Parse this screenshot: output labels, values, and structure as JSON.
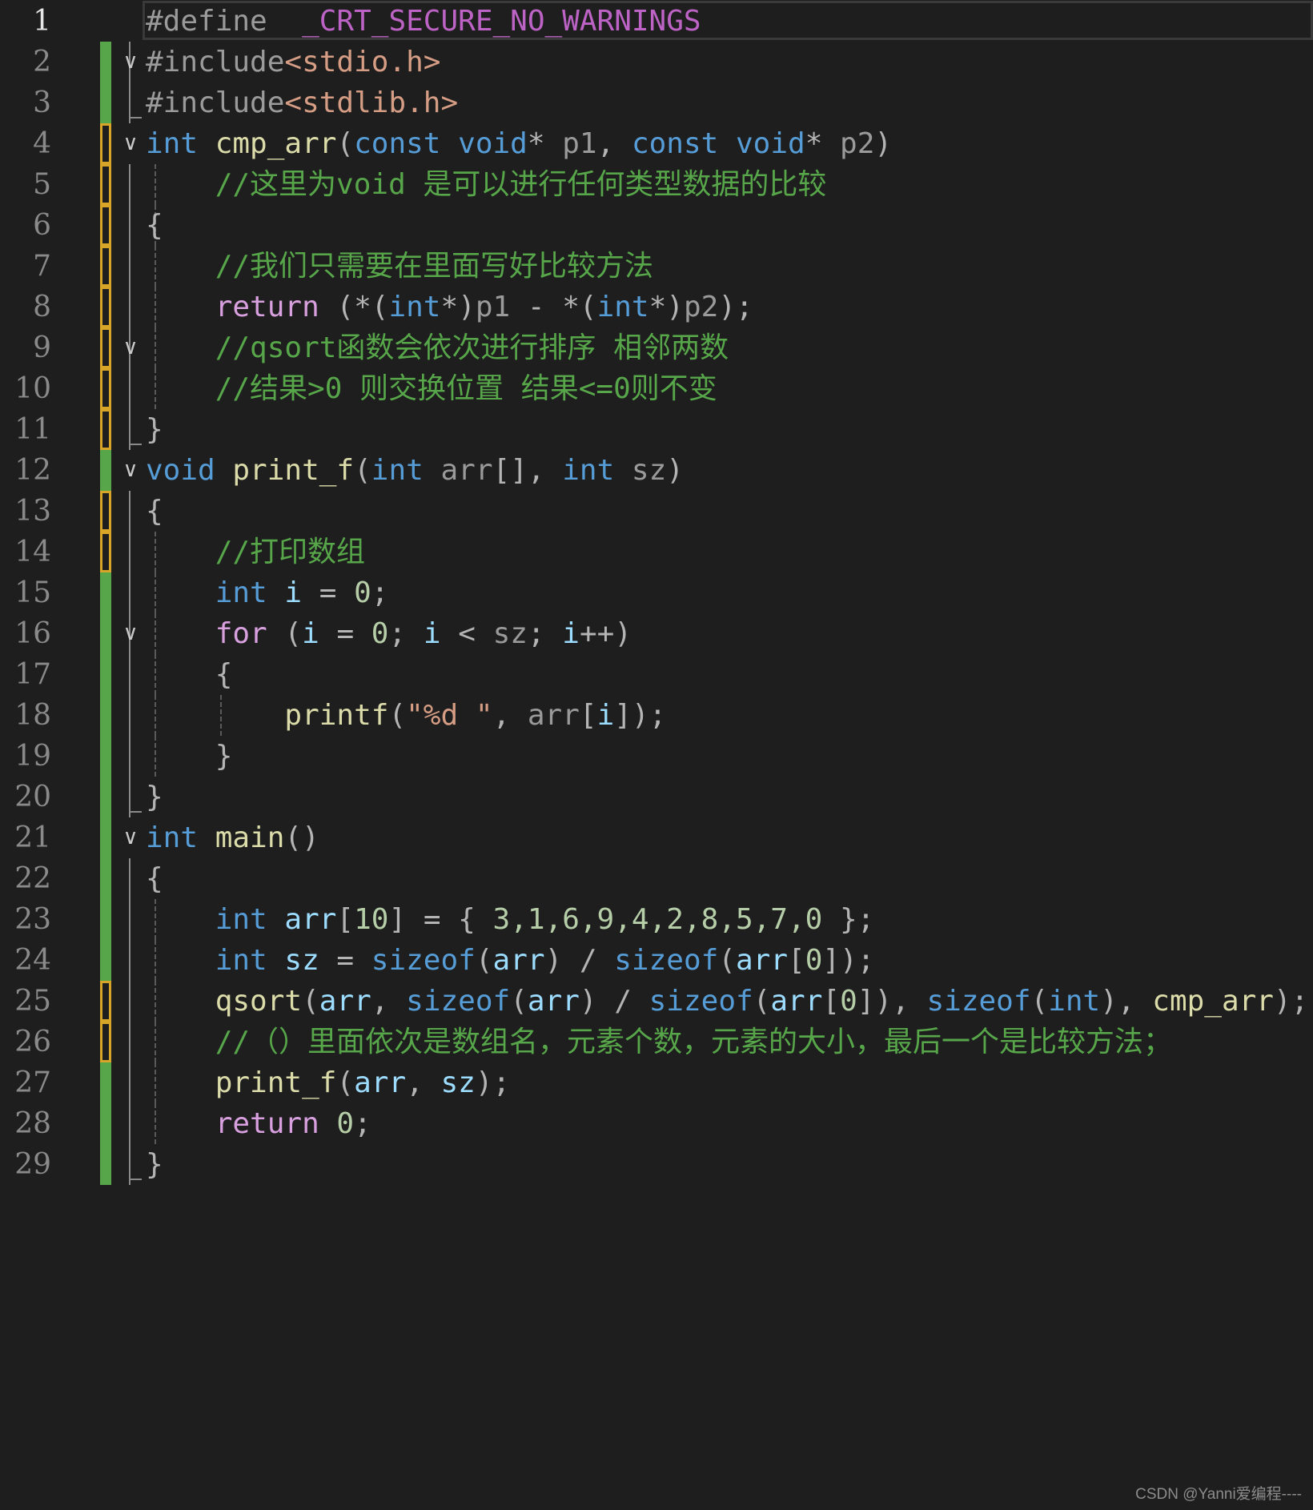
{
  "editor": {
    "lines": [
      {
        "n": "1",
        "tokens": [
          [
            "pp",
            "#define  "
          ],
          [
            "mac",
            "_CRT_SECURE_NO_WARNINGS"
          ]
        ]
      },
      {
        "n": "2",
        "tokens": [
          [
            "pp",
            "#include"
          ],
          [
            "str",
            "<stdio.h>"
          ]
        ]
      },
      {
        "n": "3",
        "tokens": [
          [
            "pp",
            "#include"
          ],
          [
            "str",
            "<stdlib.h>"
          ]
        ]
      },
      {
        "n": "4",
        "tokens": [
          [
            "kw",
            "int "
          ],
          [
            "fn",
            "cmp_arr"
          ],
          [
            "op",
            "("
          ],
          [
            "kw",
            "const void"
          ],
          [
            "op",
            "* "
          ],
          [
            "par",
            "p1"
          ],
          [
            "op",
            ", "
          ],
          [
            "kw",
            "const void"
          ],
          [
            "op",
            "* "
          ],
          [
            "par",
            "p2"
          ],
          [
            "op",
            ")"
          ]
        ]
      },
      {
        "n": "5",
        "tokens": [
          [
            "cmt",
            "    //这里为void 是可以进行任何类型数据的比较"
          ]
        ]
      },
      {
        "n": "6",
        "tokens": [
          [
            "op",
            "{"
          ]
        ]
      },
      {
        "n": "7",
        "tokens": [
          [
            "cmt",
            "    //我们只需要在里面写好比较方法"
          ]
        ]
      },
      {
        "n": "8",
        "tokens": [
          [
            "ctl",
            "    return "
          ],
          [
            "op",
            "(*("
          ],
          [
            "kw",
            "int"
          ],
          [
            "op",
            "*)"
          ],
          [
            "par",
            "p1"
          ],
          [
            "op",
            " - *("
          ],
          [
            "kw",
            "int"
          ],
          [
            "op",
            "*)"
          ],
          [
            "par",
            "p2"
          ],
          [
            "op",
            ");"
          ]
        ]
      },
      {
        "n": "9",
        "tokens": [
          [
            "cmt",
            "    //qsort函数会依次进行排序 相邻两数"
          ]
        ]
      },
      {
        "n": "10",
        "tokens": [
          [
            "cmt",
            "    //结果>0 则交换位置 结果<=0则不变"
          ]
        ]
      },
      {
        "n": "11",
        "tokens": [
          [
            "op",
            "}"
          ]
        ]
      },
      {
        "n": "12",
        "tokens": [
          [
            "kw",
            "void "
          ],
          [
            "fn",
            "print_f"
          ],
          [
            "op",
            "("
          ],
          [
            "kw",
            "int "
          ],
          [
            "par",
            "arr"
          ],
          [
            "op",
            "[], "
          ],
          [
            "kw",
            "int "
          ],
          [
            "par",
            "sz"
          ],
          [
            "op",
            ")"
          ]
        ]
      },
      {
        "n": "13",
        "tokens": [
          [
            "op",
            "{"
          ]
        ]
      },
      {
        "n": "14",
        "tokens": [
          [
            "cmt",
            "    //打印数组"
          ]
        ]
      },
      {
        "n": "15",
        "tokens": [
          [
            "kw",
            "    int "
          ],
          [
            "var",
            "i"
          ],
          [
            "op",
            " = "
          ],
          [
            "num",
            "0"
          ],
          [
            "op",
            ";"
          ]
        ]
      },
      {
        "n": "16",
        "tokens": [
          [
            "ctl",
            "    for "
          ],
          [
            "op",
            "("
          ],
          [
            "var",
            "i"
          ],
          [
            "op",
            " = "
          ],
          [
            "num",
            "0"
          ],
          [
            "op",
            "; "
          ],
          [
            "var",
            "i"
          ],
          [
            "op",
            " < "
          ],
          [
            "par",
            "sz"
          ],
          [
            "op",
            "; "
          ],
          [
            "var",
            "i"
          ],
          [
            "op",
            "++)"
          ]
        ]
      },
      {
        "n": "17",
        "tokens": [
          [
            "op",
            "    {"
          ]
        ]
      },
      {
        "n": "18",
        "tokens": [
          [
            "fn",
            "        printf"
          ],
          [
            "op",
            "("
          ],
          [
            "str",
            "\"%d \""
          ],
          [
            "op",
            ", "
          ],
          [
            "par",
            "arr"
          ],
          [
            "op",
            "["
          ],
          [
            "var",
            "i"
          ],
          [
            "op",
            "]);"
          ]
        ]
      },
      {
        "n": "19",
        "tokens": [
          [
            "op",
            "    }"
          ]
        ]
      },
      {
        "n": "20",
        "tokens": [
          [
            "op",
            "}"
          ]
        ]
      },
      {
        "n": "21",
        "tokens": [
          [
            "kw",
            "int "
          ],
          [
            "fn",
            "main"
          ],
          [
            "op",
            "()"
          ]
        ]
      },
      {
        "n": "22",
        "tokens": [
          [
            "op",
            "{"
          ]
        ]
      },
      {
        "n": "23",
        "tokens": [
          [
            "kw",
            "    int "
          ],
          [
            "var",
            "arr"
          ],
          [
            "op",
            "["
          ],
          [
            "num",
            "10"
          ],
          [
            "op",
            "] = { "
          ],
          [
            "num",
            "3,1,6,9,4,2,8,5,7,0"
          ],
          [
            "op",
            " };"
          ]
        ]
      },
      {
        "n": "24",
        "tokens": [
          [
            "kw",
            "    int "
          ],
          [
            "var",
            "sz"
          ],
          [
            "op",
            " = "
          ],
          [
            "kw",
            "sizeof"
          ],
          [
            "op",
            "("
          ],
          [
            "var",
            "arr"
          ],
          [
            "op",
            ") / "
          ],
          [
            "kw",
            "sizeof"
          ],
          [
            "op",
            "("
          ],
          [
            "var",
            "arr"
          ],
          [
            "op",
            "["
          ],
          [
            "num",
            "0"
          ],
          [
            "op",
            "]);"
          ]
        ]
      },
      {
        "n": "25",
        "tokens": [
          [
            "fn",
            "    qsort"
          ],
          [
            "op",
            "("
          ],
          [
            "var",
            "arr"
          ],
          [
            "op",
            ", "
          ],
          [
            "kw",
            "sizeof"
          ],
          [
            "op",
            "("
          ],
          [
            "var",
            "arr"
          ],
          [
            "op",
            ") / "
          ],
          [
            "kw",
            "sizeof"
          ],
          [
            "op",
            "("
          ],
          [
            "var",
            "arr"
          ],
          [
            "op",
            "["
          ],
          [
            "num",
            "0"
          ],
          [
            "op",
            "]), "
          ],
          [
            "kw",
            "sizeof"
          ],
          [
            "op",
            "("
          ],
          [
            "kw",
            "int"
          ],
          [
            "op",
            "), "
          ],
          [
            "fn",
            "cmp_arr"
          ],
          [
            "op",
            ");"
          ]
        ]
      },
      {
        "n": "26",
        "tokens": [
          [
            "cmt",
            "    //（）里面依次是数组名，元素个数，元素的大小，最后一个是比较方法；"
          ]
        ]
      },
      {
        "n": "27",
        "tokens": [
          [
            "fn",
            "    print_f"
          ],
          [
            "op",
            "("
          ],
          [
            "var",
            "arr"
          ],
          [
            "op",
            ", "
          ],
          [
            "var",
            "sz"
          ],
          [
            "op",
            ");"
          ]
        ]
      },
      {
        "n": "28",
        "tokens": [
          [
            "ctl",
            "    return "
          ],
          [
            "num",
            "0"
          ],
          [
            "op",
            ";"
          ]
        ]
      },
      {
        "n": "29",
        "tokens": [
          [
            "op",
            "}"
          ]
        ]
      }
    ],
    "change_bars": [
      "none",
      "green",
      "green",
      "yellow",
      "yellow",
      "yellow",
      "yellow",
      "yellow",
      "yellow",
      "yellow",
      "yellow",
      "green",
      "yellow",
      "yellow",
      "green",
      "green",
      "green",
      "green",
      "green",
      "green",
      "green",
      "green",
      "green",
      "green",
      "yellow",
      "yellow",
      "green",
      "green",
      "green"
    ],
    "fold_markers": [
      "",
      "chevron-down",
      "",
      "chevron-down",
      "",
      "",
      "",
      "",
      "chevron-down",
      "",
      "",
      "chevron-down",
      "",
      "",
      "",
      "chevron-down",
      "",
      "",
      "",
      "",
      "chevron-down",
      "",
      "",
      "",
      "",
      "",
      "",
      "",
      ""
    ],
    "colors": {
      "background": "#1e1e1e",
      "keyword": "#569cd6",
      "control": "#d8a0df",
      "function": "#dcdcaa",
      "string": "#d69d85",
      "comment": "#57a64a",
      "number": "#b5cea8",
      "variable": "#9cdcfe",
      "macro": "#bd63c5",
      "change_bar_saved": "#57a64a",
      "change_bar_unsaved": "#d7a629"
    }
  },
  "watermark": "CSDN @Yanni爱编程----"
}
